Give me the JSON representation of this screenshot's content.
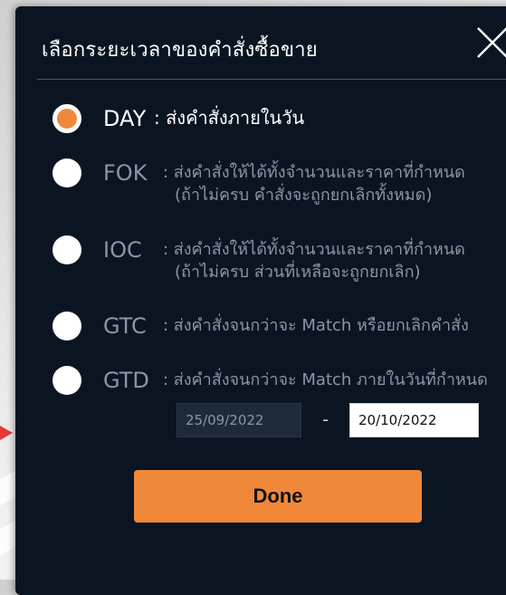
{
  "dialog": {
    "title": "เลือกระยะเวลาของคำสั่งซื้อขาย",
    "close_icon": "close-icon"
  },
  "options": [
    {
      "code": "DAY",
      "desc": ": ส่งคำสั่งภายในวัน",
      "desc2": "",
      "selected": true
    },
    {
      "code": "FOK",
      "desc": ": ส่งคำสั่งให้ได้ทั้งจำนวนและราคาที่กำหนด",
      "desc2": "(ถ้าไม่ครบ คำสั่งจะถูกยกเลิกทั้งหมด)",
      "selected": false
    },
    {
      "code": "IOC",
      "desc": ": ส่งคำสั่งให้ได้ทั้งจำนวนและราคาที่กำหนด",
      "desc2": "(ถ้าไม่ครบ ส่วนที่เหลือจะถูกยกเลิก)",
      "selected": false
    },
    {
      "code": "GTC",
      "desc": ": ส่งคำสั่งจนกว่าจะ Match หรือยกเลิกคำสั่ง",
      "desc2": "",
      "selected": false
    },
    {
      "code": "GTD",
      "desc": ": ส่งคำสั่งจนกว่าจะ Match ภายในวันที่กำหนด",
      "desc2": "",
      "selected": false
    }
  ],
  "dates": {
    "from": "25/09/2022",
    "separator": "-",
    "to": "20/10/2022"
  },
  "done_label": "Done",
  "colors": {
    "accent": "#f0883a",
    "background": "#0b1522",
    "text_active": "#ffffff",
    "text_muted": "#8b95a5"
  }
}
